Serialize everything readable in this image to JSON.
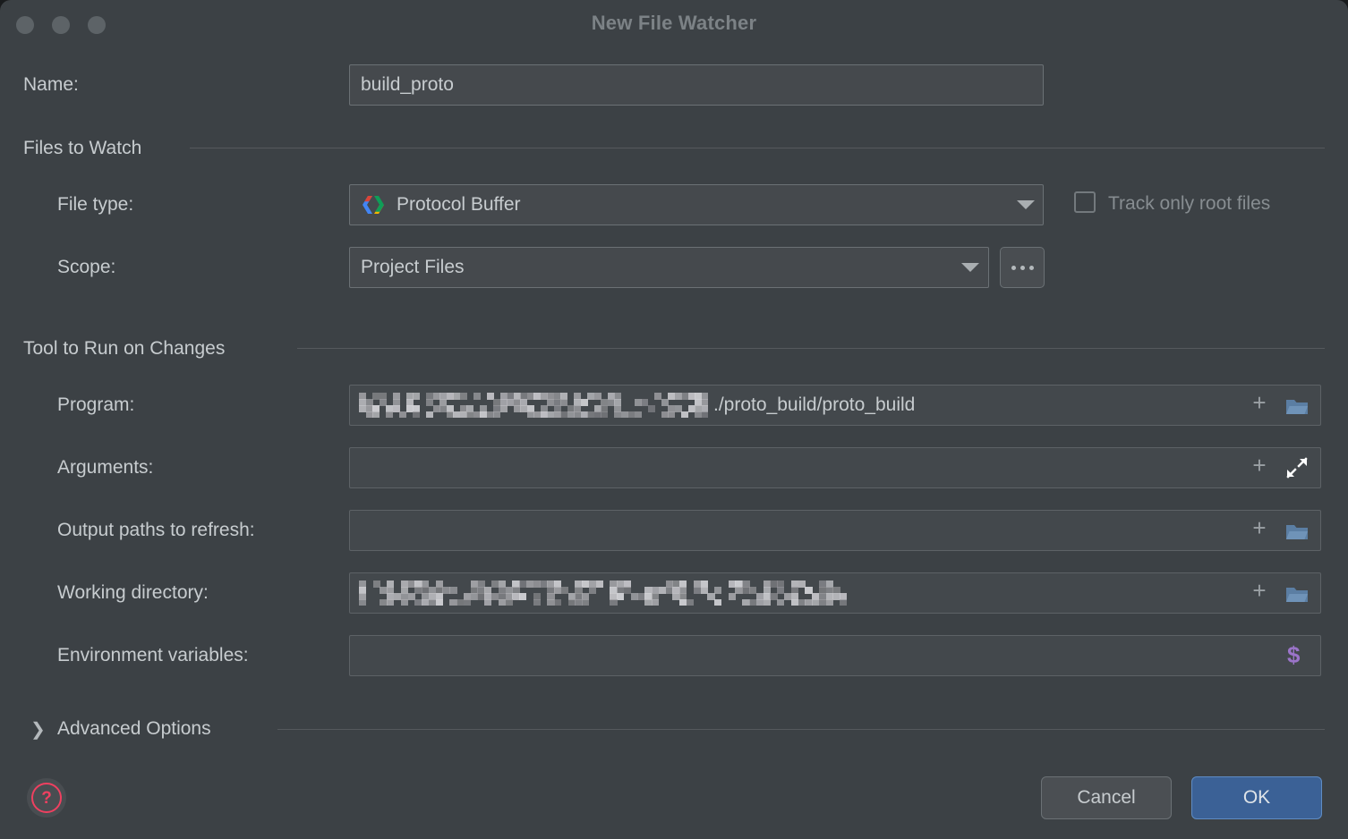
{
  "window": {
    "title": "New File Watcher",
    "traffic_lights": [
      "close",
      "minimize",
      "zoom"
    ]
  },
  "name_row": {
    "label": "Name:",
    "value": "build_proto",
    "placeholder": ""
  },
  "sections": [
    {
      "id": "files_to_watch",
      "title": "Files to Watch"
    },
    {
      "id": "tool_to_run",
      "title": "Tool to Run on Changes"
    }
  ],
  "files_to_watch": {
    "file_type": {
      "label": "File type:",
      "value": "Protocol Buffer",
      "icon": "protocol-buffer-icon"
    },
    "scope": {
      "label": "Scope:",
      "value": "Project Files",
      "browse_label": "..."
    },
    "track_only_root_files": {
      "label": "Track only root files",
      "checked": false
    }
  },
  "tool_to_run": {
    "program": {
      "label": "Program:",
      "value_redacted": true,
      "value_suffix": "./proto_build/proto_build",
      "add_icon": "plus-icon",
      "browse_icon": "folder-icon"
    },
    "arguments": {
      "label": "Arguments:",
      "value": "",
      "add_icon": "plus-icon",
      "expand_icon": "expand-icon"
    },
    "output_paths": {
      "label": "Output paths to refresh:",
      "value": "",
      "add_icon": "plus-icon",
      "browse_icon": "folder-icon"
    },
    "working_directory": {
      "label": "Working directory:",
      "value_redacted": true,
      "value_suffix": "",
      "add_icon": "plus-icon",
      "browse_icon": "folder-icon"
    },
    "environment_variables": {
      "label": "Environment variables:",
      "value": "",
      "macro_icon": "dollar-icon"
    }
  },
  "advanced_options": {
    "label": "Advanced Options",
    "expanded": false,
    "chevron": "chevron-right-icon"
  },
  "footer": {
    "help_label": "?",
    "cancel_label": "Cancel",
    "ok_label": "OK"
  },
  "colors": {
    "dialog_bg": "#3c4145",
    "field_bg": "#45494d",
    "field_border": "#6b7175",
    "text": "#c7cccf",
    "muted_text": "#878d91",
    "title_text": "#7c8286",
    "ok_button": "#3b6196",
    "ok_button_border": "#5f8cc4",
    "help_accent": "#ef4060",
    "macro_accent": "#9b74c9",
    "folder_icon": "#5b7ea3"
  }
}
